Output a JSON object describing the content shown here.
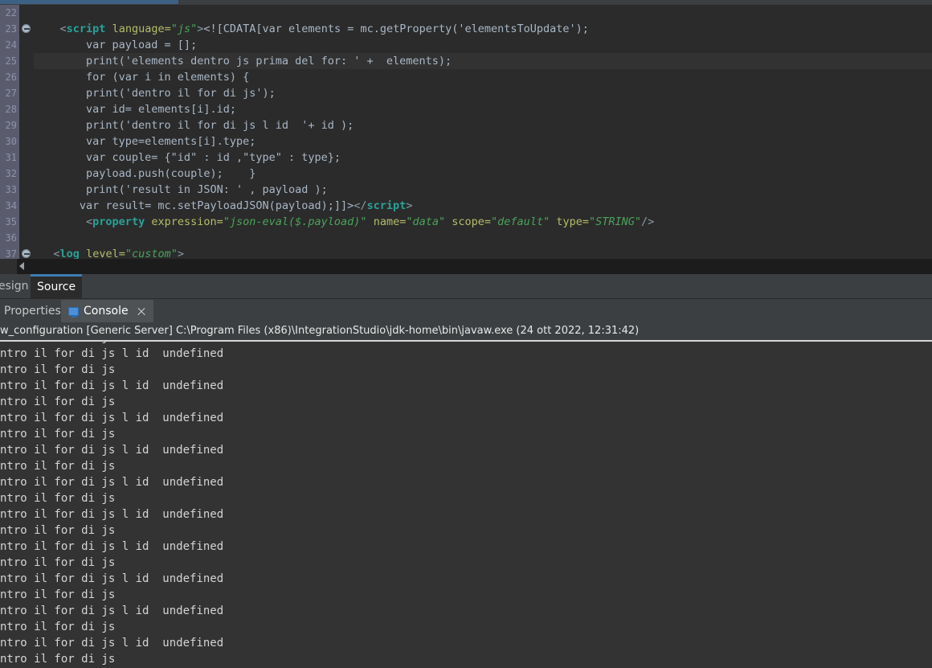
{
  "window": {
    "theme_bg": "#2b2b2b",
    "accent": "#3d7fb5",
    "panel_bg": "#3c3f41",
    "console_bg": "#333333",
    "gutter_bg": "#5a5c6e"
  },
  "editor": {
    "line_numbers": [
      "22",
      "23",
      "24",
      "25",
      "26",
      "27",
      "28",
      "29",
      "30",
      "31",
      "32",
      "33",
      "34",
      "35",
      "36",
      "37"
    ],
    "fold_markers": [
      1,
      15
    ],
    "highlighted_line_index": 3,
    "lines": [
      {
        "n": "22",
        "segments": []
      },
      {
        "n": "23",
        "segments": [
          {
            "t": "    ",
            "c": "plain"
          },
          {
            "t": "<",
            "c": "tagp"
          },
          {
            "t": "script",
            "c": "kw"
          },
          {
            "t": " ",
            "c": "plain"
          },
          {
            "t": "language=",
            "c": "attr"
          },
          {
            "t": "\"js\"",
            "c": "str"
          },
          {
            "t": ">",
            "c": "tagp"
          },
          {
            "t": "<![CDATA[var elements = mc.getProperty('elementsToUpdate');",
            "c": "cdata"
          }
        ]
      },
      {
        "n": "24",
        "segments": [
          {
            "t": "        var payload = [];",
            "c": "cdata"
          }
        ]
      },
      {
        "n": "25",
        "segments": [
          {
            "t": "        print('elements dentro js prima del for: ' +  elements);",
            "c": "cdata"
          }
        ]
      },
      {
        "n": "26",
        "segments": [
          {
            "t": "        for (var i in elements) {",
            "c": "cdata"
          }
        ]
      },
      {
        "n": "27",
        "segments": [
          {
            "t": "        print('dentro il for di js');",
            "c": "cdata"
          }
        ]
      },
      {
        "n": "28",
        "segments": [
          {
            "t": "        var id= elements[i].id;",
            "c": "cdata"
          }
        ]
      },
      {
        "n": "29",
        "segments": [
          {
            "t": "        print('dentro il for di js l id  '+ id );",
            "c": "cdata"
          }
        ]
      },
      {
        "n": "30",
        "segments": [
          {
            "t": "        var type=elements[i].type;",
            "c": "cdata"
          }
        ]
      },
      {
        "n": "31",
        "segments": [
          {
            "t": "        var couple= {\"id\" : id ,\"type\" : type};",
            "c": "cdata"
          }
        ]
      },
      {
        "n": "32",
        "segments": [
          {
            "t": "        payload.push(couple);    }",
            "c": "cdata"
          }
        ]
      },
      {
        "n": "33",
        "segments": [
          {
            "t": "        print('result in JSON: ' , payload );",
            "c": "cdata"
          }
        ]
      },
      {
        "n": "34",
        "segments": [
          {
            "t": "       var result= mc.setPayloadJSON(payload);]]>",
            "c": "cdata"
          },
          {
            "t": "</",
            "c": "tagp"
          },
          {
            "t": "script",
            "c": "kw"
          },
          {
            "t": ">",
            "c": "tagp"
          }
        ]
      },
      {
        "n": "35",
        "segments": [
          {
            "t": "        ",
            "c": "plain"
          },
          {
            "t": "<",
            "c": "tagp"
          },
          {
            "t": "property",
            "c": "kw"
          },
          {
            "t": " ",
            "c": "plain"
          },
          {
            "t": "expression=",
            "c": "attr"
          },
          {
            "t": "\"json-eval($.payload)\"",
            "c": "str"
          },
          {
            "t": " ",
            "c": "plain"
          },
          {
            "t": "name=",
            "c": "attr"
          },
          {
            "t": "\"data\"",
            "c": "str"
          },
          {
            "t": " ",
            "c": "plain"
          },
          {
            "t": "scope=",
            "c": "attr"
          },
          {
            "t": "\"default\"",
            "c": "str"
          },
          {
            "t": " ",
            "c": "plain"
          },
          {
            "t": "type=",
            "c": "attr"
          },
          {
            "t": "\"STRING\"",
            "c": "str"
          },
          {
            "t": "/>",
            "c": "tagp"
          }
        ]
      },
      {
        "n": "36",
        "segments": []
      },
      {
        "n": "37",
        "segments": [
          {
            "t": "   ",
            "c": "plain"
          },
          {
            "t": "<",
            "c": "tagp"
          },
          {
            "t": "log",
            "c": "kw"
          },
          {
            "t": " ",
            "c": "plain"
          },
          {
            "t": "level=",
            "c": "attr"
          },
          {
            "t": "\"custom\"",
            "c": "str"
          },
          {
            "t": ">",
            "c": "tagp"
          }
        ]
      }
    ]
  },
  "editor_tabs": {
    "design_label": "esign",
    "source_label": "Source",
    "selected": "Source"
  },
  "view_tabs": {
    "properties_label": "Properties",
    "console_label": "Console",
    "console_icon": "monitor-icon",
    "close_icon": "close-icon",
    "selected": "Console"
  },
  "console": {
    "header": "w_configuration [Generic Server] C:\\Program Files (x86)\\IntegrationStudio\\jdk-home\\bin\\javaw.exe  (24 ott 2022, 12:31:42)",
    "partial_top_line": "ntro il for di js",
    "lines": [
      "ntro il for di js l id  undefined",
      "ntro il for di js",
      "ntro il for di js l id  undefined",
      "ntro il for di js",
      "ntro il for di js l id  undefined",
      "ntro il for di js",
      "ntro il for di js l id  undefined",
      "ntro il for di js",
      "ntro il for di js l id  undefined",
      "ntro il for di js",
      "ntro il for di js l id  undefined",
      "ntro il for di js",
      "ntro il for di js l id  undefined",
      "ntro il for di js",
      "ntro il for di js l id  undefined",
      "ntro il for di js",
      "ntro il for di js l id  undefined",
      "ntro il for di js",
      "ntro il for di js l id  undefined",
      "ntro il for di js"
    ]
  },
  "scrollbar": {
    "left_arrow_icon": "arrow-left-icon"
  }
}
